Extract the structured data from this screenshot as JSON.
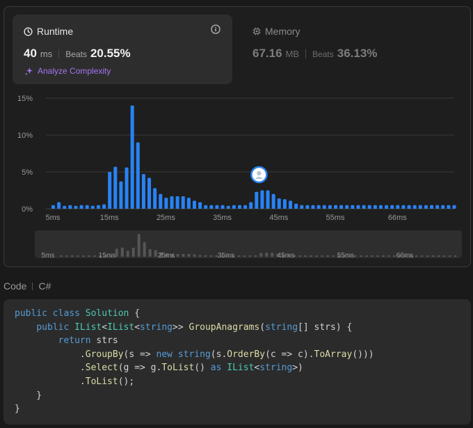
{
  "runtime": {
    "title": "Runtime",
    "value": "40",
    "unit": "ms",
    "beats_label": "Beats",
    "beats_value": "20.55%",
    "analyze_label": "Analyze Complexity",
    "info_icon": "info-circle-icon",
    "clock_icon": "clock-icon"
  },
  "memory": {
    "title": "Memory",
    "value": "67.16",
    "unit": "MB",
    "beats_label": "Beats",
    "beats_value": "36.13%",
    "chip_icon": "chip-icon"
  },
  "colors": {
    "bar": "#2883f5",
    "bar_mini": "#555555",
    "accent_purple": "#a375f0",
    "keyword": "#569cd6",
    "type": "#4ec9b0",
    "method": "#dcdcaa"
  },
  "chart_data": {
    "type": "bar",
    "title": "",
    "xlabel": "",
    "ylabel": "",
    "x_tick_labels": [
      "5ms",
      "15ms",
      "25ms",
      "35ms",
      "45ms",
      "55ms",
      "66ms"
    ],
    "y_tick_labels": [
      "15%",
      "10%",
      "5%",
      "0%"
    ],
    "ylim": [
      0,
      15
    ],
    "grid": true,
    "highlight_bar_index": 36,
    "values": [
      0.5,
      0.9,
      0.4,
      0.5,
      0.4,
      0.5,
      0.5,
      0.4,
      0.5,
      0.6,
      5.0,
      5.7,
      3.7,
      5.6,
      14.0,
      9.0,
      4.7,
      4.2,
      2.8,
      2.0,
      1.5,
      1.7,
      1.7,
      1.7,
      1.5,
      1.1,
      0.9,
      0.5,
      0.5,
      0.5,
      0.5,
      0.4,
      0.5,
      0.5,
      0.5,
      0.9,
      2.3,
      2.5,
      2.5,
      2.0,
      1.4,
      1.3,
      1.1,
      0.7,
      0.5,
      0.5,
      0.5,
      0.5,
      0.5,
      0.5,
      0.5,
      0.5,
      0.5,
      0.5,
      0.5,
      0.5,
      0.5,
      0.5,
      0.5,
      0.5,
      0.5,
      0.5,
      0.5,
      0.5,
      0.5,
      0.5,
      0.5,
      0.5,
      0.5,
      0.5,
      0.5,
      0.5
    ]
  },
  "code": {
    "header_label": "Code",
    "language": "C#",
    "lines": [
      [
        [
          "kw",
          "public "
        ],
        [
          "kw",
          "class "
        ],
        [
          "ty",
          "Solution"
        ],
        [
          "pl",
          " {"
        ]
      ],
      [
        [
          "pl",
          "    "
        ],
        [
          "kw",
          "public "
        ],
        [
          "ty",
          "IList"
        ],
        [
          "pl",
          "<"
        ],
        [
          "ty",
          "IList"
        ],
        [
          "pl",
          "<"
        ],
        [
          "kw",
          "string"
        ],
        [
          "pl",
          ">> "
        ],
        [
          "fn",
          "GroupAnagrams"
        ],
        [
          "pl",
          "("
        ],
        [
          "kw",
          "string"
        ],
        [
          "pl",
          "[] strs) {"
        ]
      ],
      [
        [
          "pl",
          "        "
        ],
        [
          "kw",
          "return "
        ],
        [
          "pl",
          "strs"
        ]
      ],
      [
        [
          "pl",
          "            ."
        ],
        [
          "fn",
          "GroupBy"
        ],
        [
          "pl",
          "(s => "
        ],
        [
          "kw",
          "new "
        ],
        [
          "kw",
          "string"
        ],
        [
          "pl",
          "(s."
        ],
        [
          "fn",
          "OrderBy"
        ],
        [
          "pl",
          "(c => c)."
        ],
        [
          "fn",
          "ToArray"
        ],
        [
          "pl",
          "()))"
        ]
      ],
      [
        [
          "pl",
          "            ."
        ],
        [
          "fn",
          "Select"
        ],
        [
          "pl",
          "(g => g."
        ],
        [
          "fn",
          "ToList"
        ],
        [
          "pl",
          "() "
        ],
        [
          "kw",
          "as "
        ],
        [
          "ty",
          "IList"
        ],
        [
          "pl",
          "<"
        ],
        [
          "kw",
          "string"
        ],
        [
          "pl",
          ">)"
        ]
      ],
      [
        [
          "pl",
          "            ."
        ],
        [
          "fn",
          "ToList"
        ],
        [
          "pl",
          "();"
        ]
      ],
      [
        [
          "pl",
          "    }"
        ]
      ],
      [
        [
          "pl",
          "}"
        ]
      ]
    ]
  }
}
